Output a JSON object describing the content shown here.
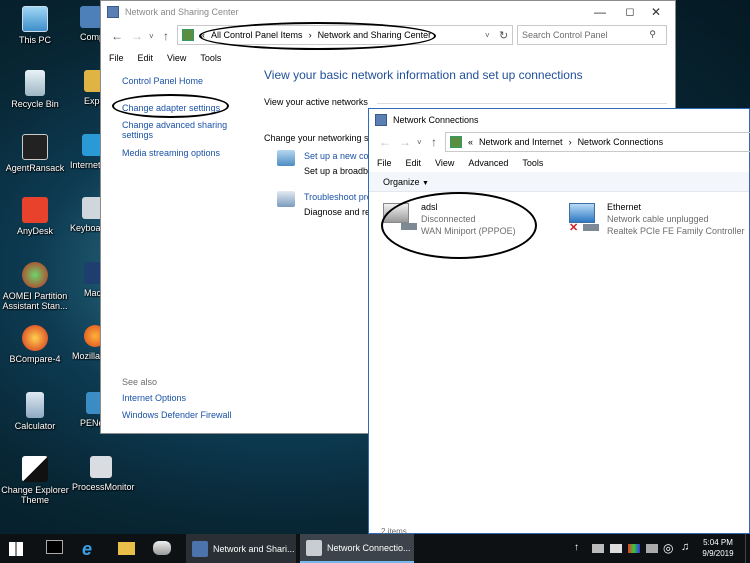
{
  "desktop": {
    "icons_left": [
      "This PC",
      "Recycle Bin",
      "AgentRansack",
      "AnyDesk",
      "AOMEI Partition Assistant Stan...",
      "BCompare-4",
      "Calculator",
      "Change Explorer Theme"
    ],
    "icons_right": [
      "Comp Pro",
      "Exp",
      "Internet",
      "Keyboa",
      "Macriun Fr",
      "Mozilla",
      "PENe",
      "ProcessMonitor"
    ]
  },
  "nsc": {
    "title": "Network and Sharing Center",
    "address": {
      "prefix": "«",
      "crumbs": [
        "All Control Panel Items",
        "Network and Sharing Center"
      ]
    },
    "search_placeholder": "Search Control Panel",
    "menu": [
      "File",
      "Edit",
      "View",
      "Tools"
    ],
    "sidebar": {
      "home": "Control Panel Home",
      "adapter": "Change adapter settings",
      "advanced": "Change advanced sharing settings",
      "media": "Media streaming options",
      "see_also": "See also",
      "internet_options": "Internet Options",
      "firewall": "Windows Defender Firewall"
    },
    "heading": "View your basic network information and set up connections",
    "active_networks": "View your active networks",
    "change_settings": "Change your networking se",
    "setup_link": "Set up a new con",
    "setup_desc": "Set up a broadba",
    "troubleshoot_link": "Troubleshoot pro",
    "troubleshoot_desc": "Diagnose and rep"
  },
  "nc": {
    "title": "Network Connections",
    "address": {
      "prefix": "«",
      "crumbs": [
        "Network and Internet",
        "Network Connections"
      ]
    },
    "menu": [
      "File",
      "Edit",
      "View",
      "Advanced",
      "Tools"
    ],
    "organize": "Organize",
    "items": [
      {
        "name": "adsl",
        "status": "Disconnected",
        "device": "WAN Miniport (PPPOE)"
      },
      {
        "name": "Ethernet",
        "status": "Network cable unplugged",
        "device": "Realtek PCIe FE Family Controller"
      }
    ],
    "statusbar": "2 items"
  },
  "taskbar": {
    "buttons": [
      "Network and Shari...",
      "Network Connectio..."
    ],
    "time": "5:04 PM",
    "date": "9/9/2019"
  }
}
